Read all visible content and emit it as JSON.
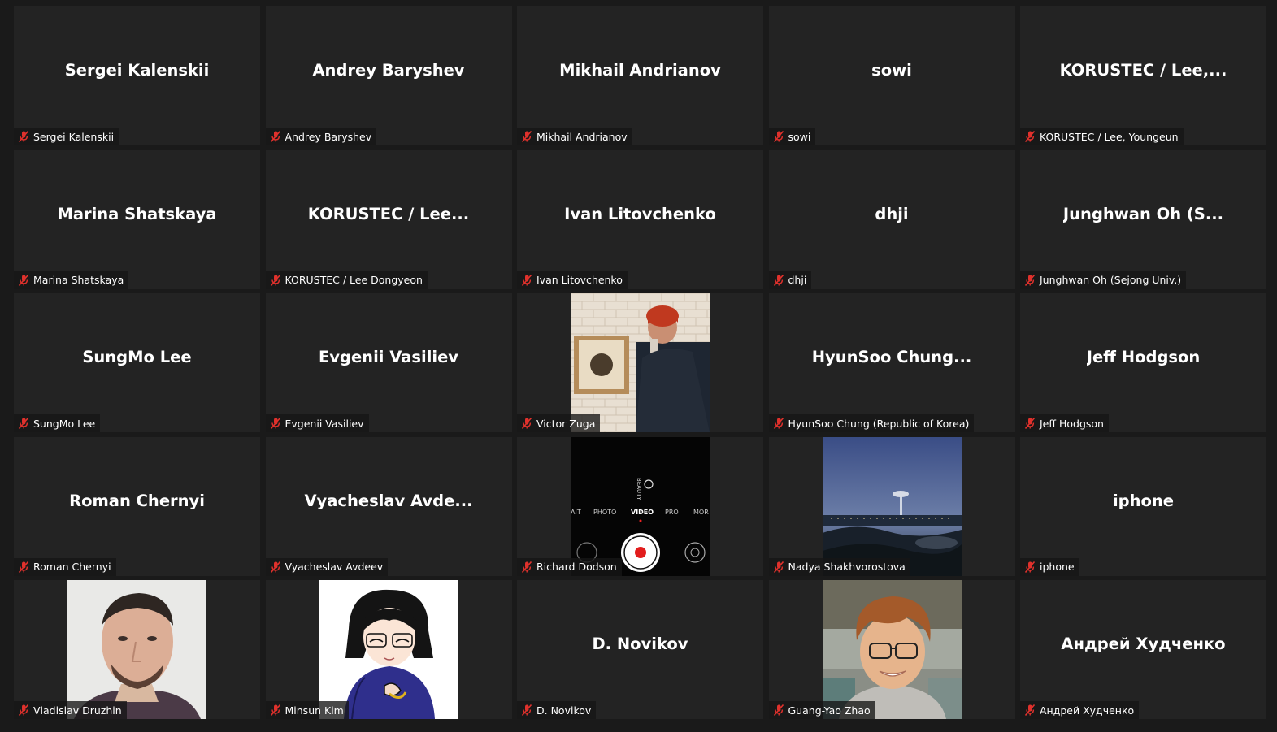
{
  "participants": [
    {
      "display": "Sergei Kalenskii",
      "label": "Sergei Kalenskii",
      "video": null
    },
    {
      "display": "Andrey Baryshev",
      "label": "Andrey Baryshev",
      "video": null
    },
    {
      "display": "Mikhail Andrianov",
      "label": "Mikhail Andrianov",
      "video": null
    },
    {
      "display": "sowi",
      "label": "sowi",
      "video": null
    },
    {
      "display": "KORUSTEC / Lee,...",
      "label": "KORUSTEC / Lee, Youngeun",
      "video": null
    },
    {
      "display": "Marina Shatskaya",
      "label": "Marina Shatskaya",
      "video": null
    },
    {
      "display": "KORUSTEC / Lee...",
      "label": "KORUSTEC / Lee Dongyeon",
      "video": null
    },
    {
      "display": "Ivan Litovchenko",
      "label": "Ivan Litovchenko",
      "video": null
    },
    {
      "display": "dhji",
      "label": "dhji",
      "video": null
    },
    {
      "display": "Junghwan Oh (S...",
      "label": "Junghwan Oh (Sejong Univ.)",
      "video": null
    },
    {
      "display": "SungMo Lee",
      "label": "SungMo Lee",
      "video": null
    },
    {
      "display": "Evgenii Vasiliev",
      "label": "Evgenii Vasiliev",
      "video": null
    },
    {
      "display": "",
      "label": "Victor Zuga",
      "video": "brick-wall"
    },
    {
      "display": "HyunSoo  Chung...",
      "label": "HyunSoo Chung (Republic of Korea)",
      "video": null
    },
    {
      "display": "Jeff Hodgson",
      "label": "Jeff Hodgson",
      "video": null
    },
    {
      "display": "Roman Chernyi",
      "label": "Roman Chernyi",
      "video": null
    },
    {
      "display": "Vyacheslav  Avde...",
      "label": "Vyacheslav Avdeev",
      "video": null
    },
    {
      "display": "",
      "label": "Richard Dodson",
      "video": "phone-camera"
    },
    {
      "display": "",
      "label": "Nadya Shakhvorostova",
      "video": "night-landscape"
    },
    {
      "display": "iphone",
      "label": "iphone",
      "video": null
    },
    {
      "display": "",
      "label": "Vladislav Druzhin",
      "video": "portrait-man"
    },
    {
      "display": "",
      "label": "Minsun Kim",
      "video": "anime-avatar"
    },
    {
      "display": "D. Novikov",
      "label": "D. Novikov",
      "video": null
    },
    {
      "display": "",
      "label": "Guang-Yao Zhao",
      "video": "selfie-outdoor"
    },
    {
      "display": "Андрей Худченко",
      "label": "Андрей Худченко",
      "video": null
    }
  ],
  "camera_app": {
    "modes": [
      "AIT",
      "PHOTO",
      "VIDEO",
      "PRO",
      "MOR"
    ],
    "active_mode": "VIDEO",
    "top_label": "BEAUTY"
  },
  "colors": {
    "tile_bg": "#232323",
    "page_bg": "#1a1a1a",
    "mute_red": "#e0312c"
  }
}
